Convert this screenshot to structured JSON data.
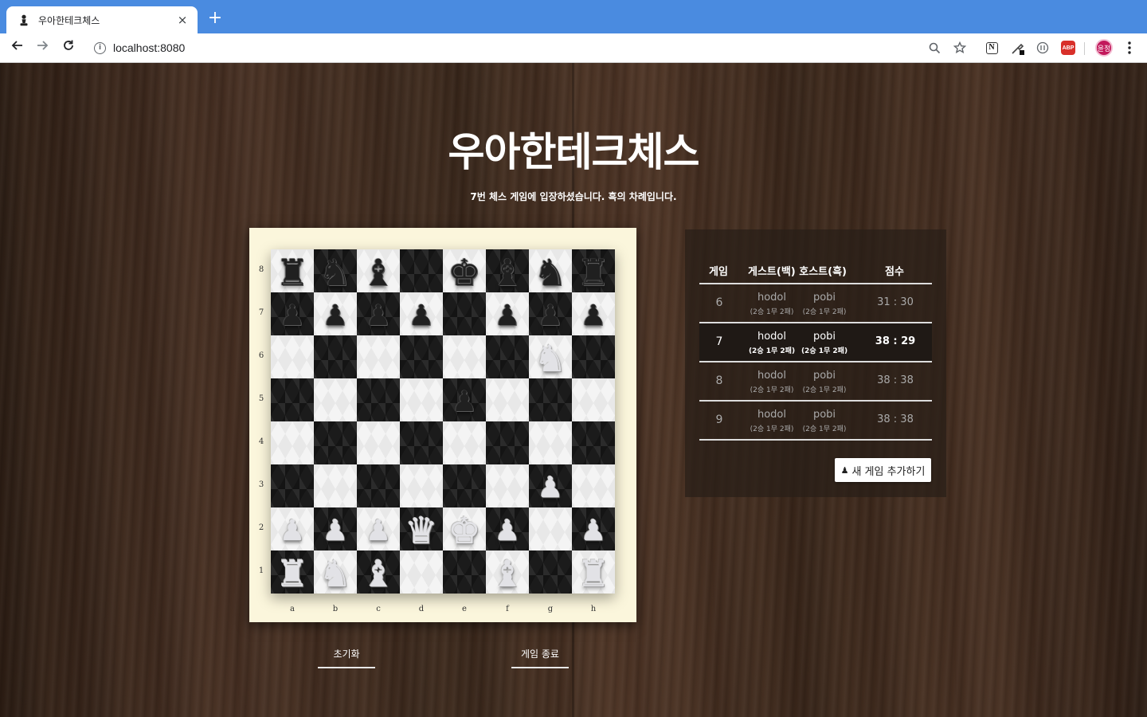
{
  "browser": {
    "tab_title": "우아한테크체스",
    "tab_icon": "chess-pawn-icon",
    "close_glyph": "×",
    "new_tab_glyph": "+",
    "url": "localhost:8080",
    "avatar_text": "윤정",
    "abp_text": "ABP",
    "notion_text": "N"
  },
  "page": {
    "title": "우아한테크체스",
    "subtitle": "7번 체스 게임에 입장하셨습니다. 흑의 차례입니다."
  },
  "board": {
    "ranks": [
      "8",
      "7",
      "6",
      "5",
      "4",
      "3",
      "2",
      "1"
    ],
    "files": [
      "a",
      "b",
      "c",
      "d",
      "e",
      "f",
      "g",
      "h"
    ],
    "position": [
      [
        "bR",
        "bN",
        "bB",
        "",
        "bK",
        "bB",
        "bN",
        "bR"
      ],
      [
        "bP",
        "bP",
        "bP",
        "bP",
        "",
        "bP",
        "bP",
        "bP"
      ],
      [
        "",
        "",
        "",
        "",
        "",
        "",
        "wN",
        ""
      ],
      [
        "",
        "",
        "",
        "",
        "bP",
        "",
        "",
        ""
      ],
      [
        "",
        "",
        "",
        "",
        "",
        "",
        "",
        ""
      ],
      [
        "",
        "",
        "",
        "",
        "",
        "",
        "wP",
        ""
      ],
      [
        "wP",
        "wP",
        "wP",
        "wQ",
        "wK",
        "wP",
        "",
        "wP"
      ],
      [
        "wR",
        "wN",
        "wB",
        "",
        "",
        "wB",
        "",
        "wR"
      ]
    ]
  },
  "buttons": {
    "reset": "초기화",
    "end_game": "게임 종료"
  },
  "game_list": {
    "headers": {
      "game": "게임",
      "players": "게스트(백) 호스트(흑)",
      "score": "점수"
    },
    "rows": [
      {
        "num": "6",
        "guest": "hodol",
        "guest_record": "(2승 1무 2패)",
        "host": "pobi",
        "host_record": "(2승 1무 2패)",
        "score": "31 : 30"
      },
      {
        "num": "7",
        "guest": "hodol",
        "guest_record": "(2승 1무 2패)",
        "host": "pobi",
        "host_record": "(2승 1무 2패)",
        "score": "38 : 29"
      },
      {
        "num": "8",
        "guest": "hodol",
        "guest_record": "(2승 1무 2패)",
        "host": "pobi",
        "host_record": "(2승 1무 2패)",
        "score": "38 : 38"
      },
      {
        "num": "9",
        "guest": "hodol",
        "guest_record": "(2승 1무 2패)",
        "host": "pobi",
        "host_record": "(2승 1무 2패)",
        "score": "38 : 38"
      }
    ],
    "active_game": "7",
    "add_button": "새 게임 추가하기",
    "add_button_icon": "chess-pawn-icon"
  },
  "colors": {
    "chrome_blue": "#4a8be0",
    "board_frame": "#fbf6dc",
    "dark_square": "#1b1b1b",
    "light_square": "#f4f4f4"
  }
}
